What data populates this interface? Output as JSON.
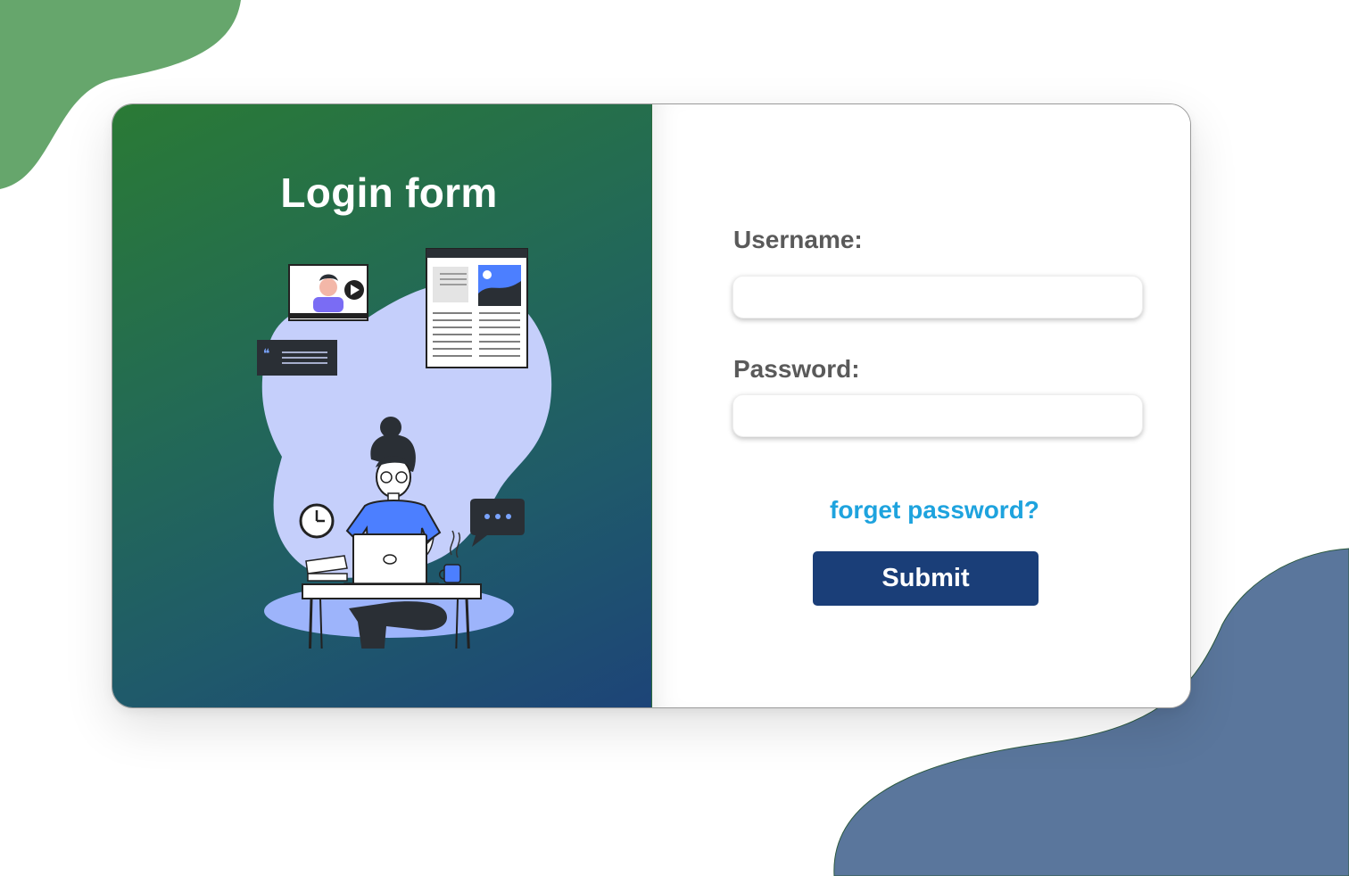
{
  "login": {
    "title": "Login form",
    "username_label": "Username:",
    "username_value": "",
    "password_label": "Password:",
    "password_value": "",
    "forgot_link": "forget password?",
    "submit_label": "Submit"
  },
  "illustration": {
    "name": "woman-working-on-laptop-illustration"
  },
  "colors": {
    "blob_top_left": "#66a66c",
    "blob_bottom_right": "#5a769c",
    "panel_gradient_start": "#2a7a35",
    "panel_gradient_end": "#1d4478",
    "label_text": "#5a5a5a",
    "link": "#1ea3de",
    "submit_button": "#1a3e78"
  }
}
